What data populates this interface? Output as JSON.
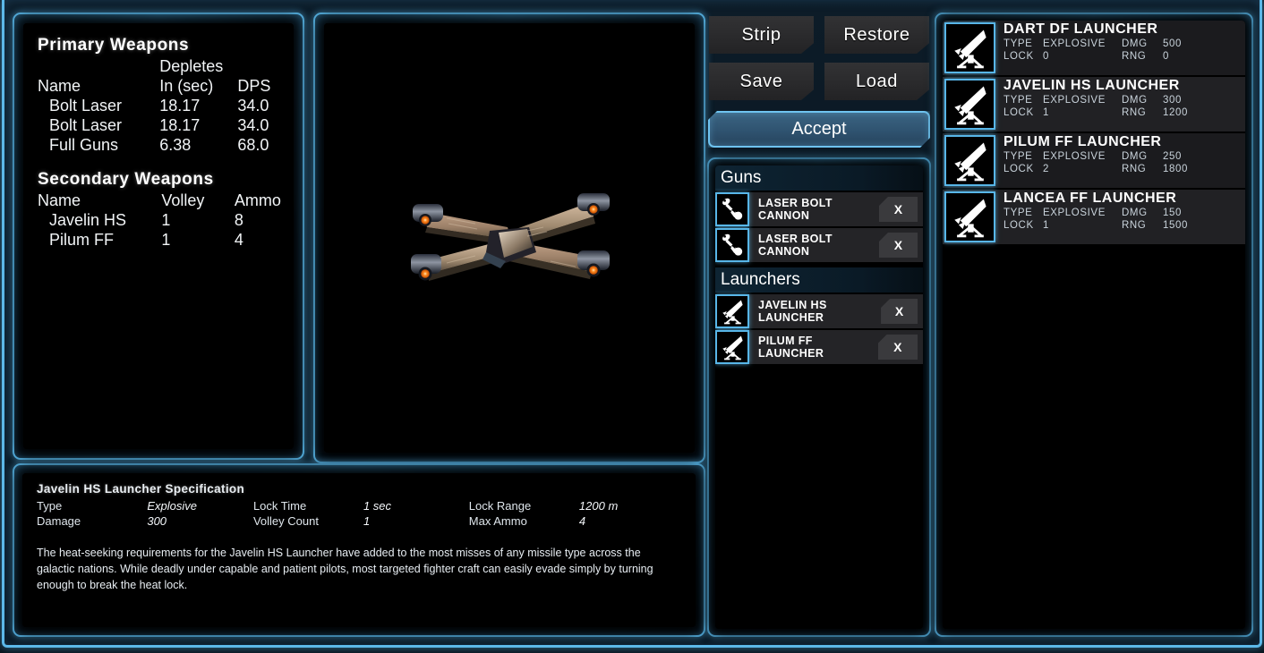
{
  "primary": {
    "heading": "Primary Weapons",
    "col_blank": "",
    "col_depletes": "Depletes",
    "col_name": "Name",
    "col_in_sec": "In (sec)",
    "col_dps": "DPS",
    "rows": [
      {
        "name": "Bolt Laser",
        "depletes": "18.17",
        "dps": "34.0"
      },
      {
        "name": "Bolt Laser",
        "depletes": "18.17",
        "dps": "34.0"
      },
      {
        "name": "Full Guns",
        "depletes": "6.38",
        "dps": "68.0"
      }
    ]
  },
  "secondary": {
    "heading": "Secondary Weapons",
    "col_name": "Name",
    "col_volley": "Volley",
    "col_ammo": "Ammo",
    "rows": [
      {
        "name": "Javelin HS",
        "volley": "1",
        "ammo": "8"
      },
      {
        "name": "Pilum FF",
        "volley": "1",
        "ammo": "4"
      }
    ]
  },
  "spec": {
    "title": "Javelin HS Launcher Specification",
    "fields": [
      {
        "key": "Type",
        "value": "Explosive"
      },
      {
        "key": "Damage",
        "value": "300"
      },
      {
        "key": "Lock Time",
        "value": "1 sec"
      },
      {
        "key": "Volley Count",
        "value": "1"
      },
      {
        "key": "Lock Range",
        "value": "1200 m"
      },
      {
        "key": "Max Ammo",
        "value": "4"
      }
    ],
    "description": "The heat-seeking requirements for the Javelin HS Launcher have added to the most misses of any missile type across the galactic nations. While deadly under capable and patient pilots, most targeted fighter craft can easily evade simply by turning enough to break the heat lock."
  },
  "commands": {
    "strip": "Strip",
    "restore": "Restore",
    "save": "Save",
    "load": "Load",
    "accept": "Accept"
  },
  "loadout": {
    "groups": [
      {
        "label": "Guns",
        "items": [
          {
            "name": "LASER BOLT CANNON",
            "remove": "X",
            "icon": "gun-icon"
          },
          {
            "name": "LASER BOLT CANNON",
            "remove": "X",
            "icon": "gun-icon"
          }
        ]
      },
      {
        "label": "Launchers",
        "items": [
          {
            "name": "JAVELIN HS LAUNCHER",
            "remove": "X",
            "icon": "launcher-icon"
          },
          {
            "name": "PILUM FF LAUNCHER",
            "remove": "X",
            "icon": "launcher-icon"
          }
        ]
      }
    ]
  },
  "inventory": {
    "labels": {
      "type": "TYPE",
      "dmg": "DMG",
      "lock": "LOCK",
      "rng": "RNG"
    },
    "items": [
      {
        "title": "DART DF LAUNCHER",
        "type": "EXPLOSIVE",
        "dmg": "500",
        "lock": "0",
        "rng": "0",
        "icon": "launcher-icon"
      },
      {
        "title": "JAVELIN HS LAUNCHER",
        "type": "EXPLOSIVE",
        "dmg": "300",
        "lock": "1",
        "rng": "1200",
        "icon": "launcher-icon"
      },
      {
        "title": "PILUM FF LAUNCHER",
        "type": "EXPLOSIVE",
        "dmg": "250",
        "lock": "2",
        "rng": "1800",
        "icon": "launcher-icon"
      },
      {
        "title": "LANCEA FF LAUNCHER",
        "type": "EXPLOSIVE",
        "dmg": "150",
        "lock": "1",
        "rng": "1500",
        "icon": "launcher-icon"
      }
    ]
  },
  "ship": {
    "label": "ship-preview"
  },
  "colors": {
    "accent": "#58b6e8",
    "panel_bg": "#0b1e2c",
    "button_bg": "#2a2a2c",
    "accept_bg": "#2f5370",
    "thruster": "#ff7a14"
  }
}
